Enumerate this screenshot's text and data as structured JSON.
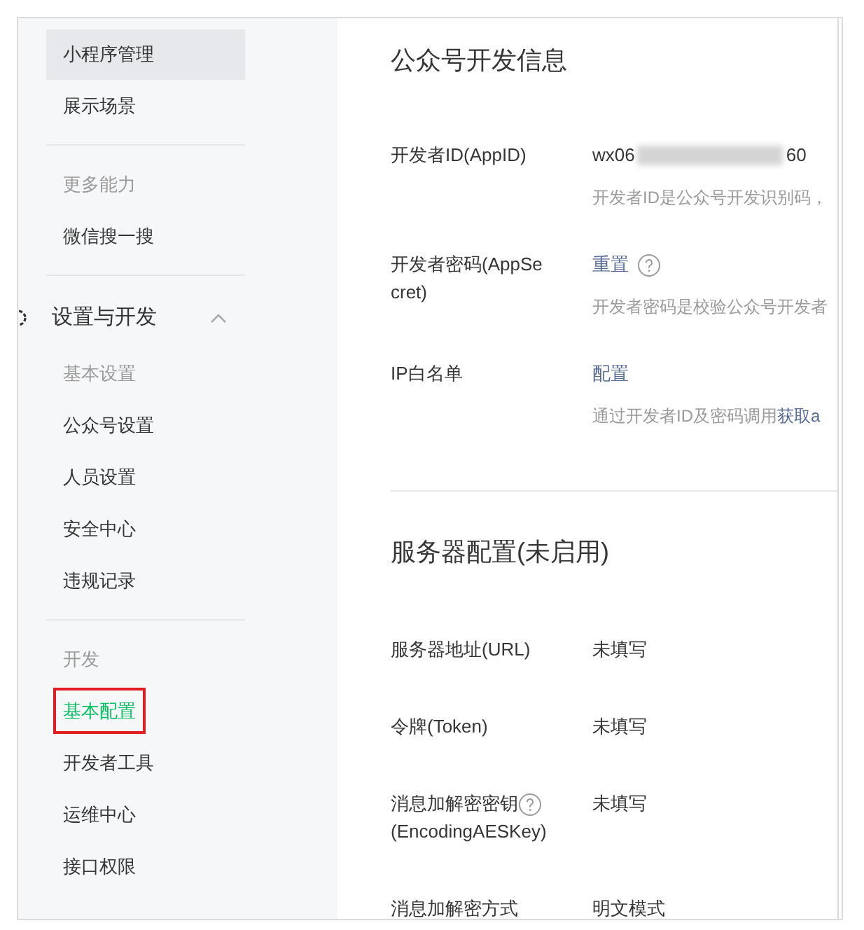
{
  "sidebar": {
    "entries": [
      {
        "kind": "item",
        "label": "小程序管理",
        "selected": false,
        "highlighted": true,
        "marked": false
      },
      {
        "kind": "item",
        "label": "展示场景",
        "selected": false,
        "highlighted": false,
        "marked": false
      },
      {
        "kind": "divider"
      },
      {
        "kind": "heading",
        "label": "更多能力"
      },
      {
        "kind": "item",
        "label": "微信搜一搜",
        "selected": false,
        "highlighted": false,
        "marked": false
      },
      {
        "kind": "divider"
      },
      {
        "kind": "section",
        "label": "设置与开发",
        "expanded": true
      },
      {
        "kind": "heading",
        "label": "基本设置"
      },
      {
        "kind": "item",
        "label": "公众号设置",
        "selected": false,
        "highlighted": false,
        "marked": false
      },
      {
        "kind": "item",
        "label": "人员设置",
        "selected": false,
        "highlighted": false,
        "marked": false
      },
      {
        "kind": "item",
        "label": "安全中心",
        "selected": false,
        "highlighted": false,
        "marked": false
      },
      {
        "kind": "item",
        "label": "违规记录",
        "selected": false,
        "highlighted": false,
        "marked": false
      },
      {
        "kind": "divider"
      },
      {
        "kind": "heading",
        "label": "开发"
      },
      {
        "kind": "item",
        "label": "基本配置",
        "selected": true,
        "highlighted": false,
        "marked": true
      },
      {
        "kind": "item",
        "label": "开发者工具",
        "selected": false,
        "highlighted": false,
        "marked": false
      },
      {
        "kind": "item",
        "label": "运维中心",
        "selected": false,
        "highlighted": false,
        "marked": false
      },
      {
        "kind": "item",
        "label": "接口权限",
        "selected": false,
        "highlighted": false,
        "marked": false
      }
    ]
  },
  "dev_info": {
    "title": "公众号开发信息",
    "rows": [
      {
        "label": "开发者ID(AppID)",
        "value_start": "wx06",
        "value_end": "60",
        "redacted": true,
        "description": "开发者ID是公众号开发识别码，"
      },
      {
        "label": "开发者密码(AppSecret)",
        "link": "重置",
        "help": true,
        "description": "开发者密码是校验公众号开发者"
      },
      {
        "label": "IP白名单",
        "link": "配置",
        "description": "通过开发者ID及密码调用",
        "description_link": "获取a"
      }
    ]
  },
  "server_config": {
    "title": "服务器配置(未启用)",
    "rows": [
      {
        "label": "服务器地址(URL)",
        "value": "未填写",
        "help": false
      },
      {
        "label": "令牌(Token)",
        "value": "未填写",
        "help": false
      },
      {
        "label": "消息加解密密钥",
        "label_2": "(EncodingAESKey)",
        "value": "未填写",
        "help": true
      },
      {
        "label": "消息加解密方式",
        "value": "明文模式",
        "help": false
      }
    ]
  }
}
